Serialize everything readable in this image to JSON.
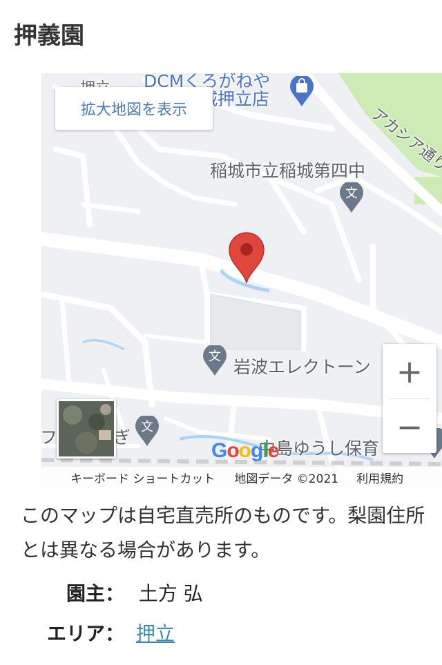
{
  "page": {
    "title": "押義園"
  },
  "map": {
    "enlarge_label": "拡大地図を表示",
    "pois": {
      "dcm": "DCMくろがねや",
      "dcm2": "城押立店",
      "oshitate": "押立",
      "school": "稲城市立稲城第四中",
      "piano": "岩波エレクトーン",
      "nursery": "中島ゆうし保育",
      "ekaki": "フ",
      "gi": "ぎ",
      "acacia": "アカシア通り"
    },
    "zoom": {
      "in": "+",
      "out": "−"
    },
    "logo": "Google",
    "attribution": {
      "shortcuts": "キーボード ショートカット",
      "data": "地図データ ©2021",
      "terms": "利用規約"
    }
  },
  "notice": "このマップは自宅直売所のものです。梨園住所とは異なる場合があります。",
  "details": {
    "owner_label": "園主：",
    "owner_value": "土方 弘",
    "area_label": "エリア：",
    "area_value": "押立"
  },
  "colors": {
    "marker": "#e0463a",
    "link": "#3b8bb5",
    "park": "#cdebb5",
    "poi_icon": "#6b7a8a"
  }
}
